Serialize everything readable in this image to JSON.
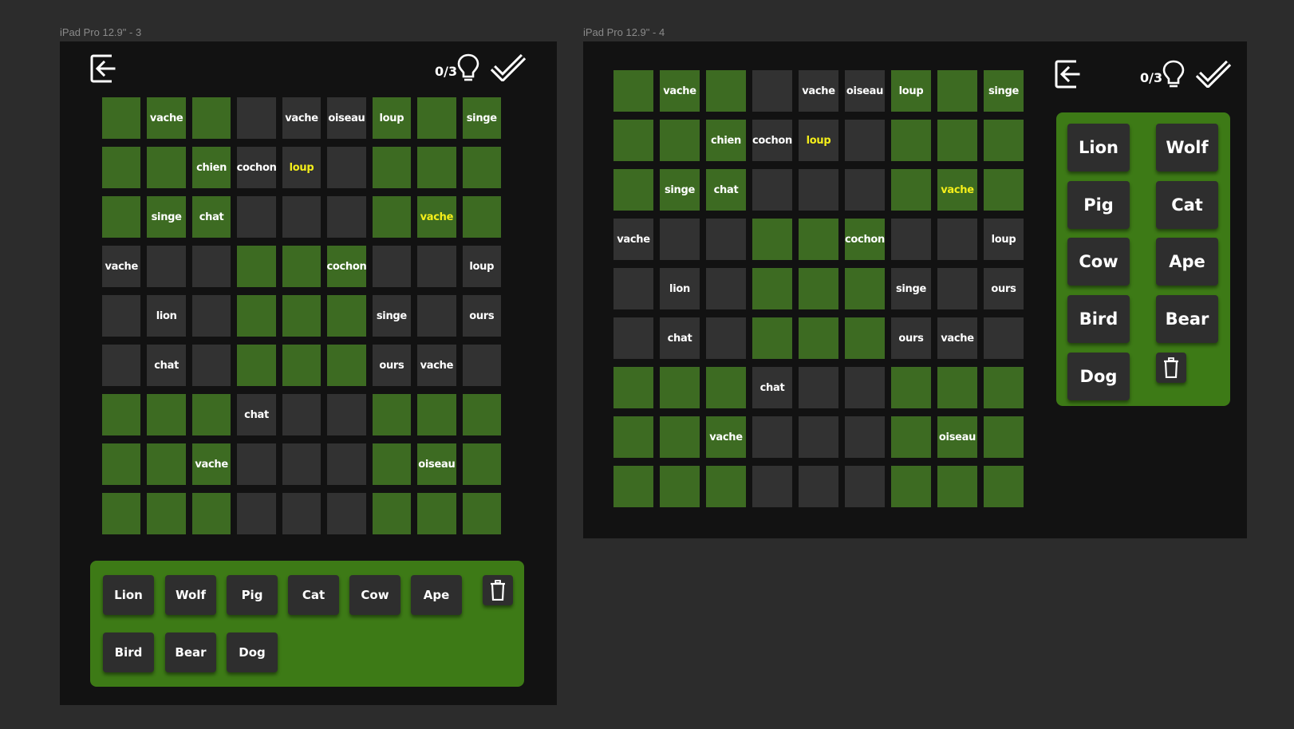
{
  "frames": [
    {
      "label": "iPad Pro 12.9\" - 3",
      "score": "0/3",
      "words": [
        "Lion",
        "Wolf",
        "Pig",
        "Cat",
        "Cow",
        "Ape",
        "Bird",
        "Bear",
        "Dog"
      ],
      "grid": [
        [
          [
            "g",
            ""
          ],
          [
            "g",
            "vache"
          ],
          [
            "g",
            ""
          ],
          [
            "d",
            ""
          ],
          [
            "d",
            "vache"
          ],
          [
            "d",
            "oiseau"
          ],
          [
            "g",
            "loup"
          ],
          [
            "g",
            ""
          ],
          [
            "g",
            "singe"
          ]
        ],
        [
          [
            "g",
            ""
          ],
          [
            "g",
            ""
          ],
          [
            "g",
            "chien"
          ],
          [
            "d",
            "cochon"
          ],
          [
            "dy",
            "loup"
          ],
          [
            "d",
            ""
          ],
          [
            "g",
            ""
          ],
          [
            "g",
            ""
          ],
          [
            "g",
            ""
          ]
        ],
        [
          [
            "g",
            ""
          ],
          [
            "g",
            "singe"
          ],
          [
            "g",
            "chat"
          ],
          [
            "d",
            ""
          ],
          [
            "d",
            ""
          ],
          [
            "d",
            ""
          ],
          [
            "g",
            ""
          ],
          [
            "gy",
            "vache"
          ],
          [
            "g",
            ""
          ]
        ],
        [
          [
            "d",
            "vache"
          ],
          [
            "d",
            ""
          ],
          [
            "d",
            ""
          ],
          [
            "g",
            ""
          ],
          [
            "g",
            ""
          ],
          [
            "g",
            "cochon"
          ],
          [
            "d",
            ""
          ],
          [
            "d",
            ""
          ],
          [
            "d",
            "loup"
          ]
        ],
        [
          [
            "d",
            ""
          ],
          [
            "d",
            "lion"
          ],
          [
            "d",
            ""
          ],
          [
            "g",
            ""
          ],
          [
            "g",
            ""
          ],
          [
            "g",
            ""
          ],
          [
            "d",
            "singe"
          ],
          [
            "d",
            ""
          ],
          [
            "d",
            "ours"
          ]
        ],
        [
          [
            "d",
            ""
          ],
          [
            "d",
            "chat"
          ],
          [
            "d",
            ""
          ],
          [
            "g",
            ""
          ],
          [
            "g",
            ""
          ],
          [
            "g",
            ""
          ],
          [
            "d",
            "ours"
          ],
          [
            "d",
            "vache"
          ],
          [
            "d",
            ""
          ]
        ],
        [
          [
            "g",
            ""
          ],
          [
            "g",
            ""
          ],
          [
            "g",
            ""
          ],
          [
            "d",
            "chat"
          ],
          [
            "d",
            ""
          ],
          [
            "d",
            ""
          ],
          [
            "g",
            ""
          ],
          [
            "g",
            ""
          ],
          [
            "g",
            ""
          ]
        ],
        [
          [
            "g",
            ""
          ],
          [
            "g",
            ""
          ],
          [
            "g",
            "vache"
          ],
          [
            "d",
            ""
          ],
          [
            "d",
            ""
          ],
          [
            "d",
            ""
          ],
          [
            "g",
            ""
          ],
          [
            "g",
            "oiseau"
          ],
          [
            "g",
            ""
          ]
        ],
        [
          [
            "g",
            ""
          ],
          [
            "g",
            ""
          ],
          [
            "g",
            ""
          ],
          [
            "d",
            ""
          ],
          [
            "d",
            ""
          ],
          [
            "d",
            ""
          ],
          [
            "g",
            ""
          ],
          [
            "g",
            ""
          ],
          [
            "g",
            ""
          ]
        ]
      ]
    },
    {
      "label": "iPad Pro 12.9\" - 4",
      "score": "0/3",
      "words": [
        "Lion",
        "Wolf",
        "Pig",
        "Cat",
        "Cow",
        "Ape",
        "Bird",
        "Bear",
        "Dog"
      ],
      "grid": [
        [
          [
            "g",
            ""
          ],
          [
            "g",
            "vache"
          ],
          [
            "g",
            ""
          ],
          [
            "d",
            ""
          ],
          [
            "d",
            "vache"
          ],
          [
            "d",
            "oiseau"
          ],
          [
            "g",
            "loup"
          ],
          [
            "g",
            ""
          ],
          [
            "g",
            "singe"
          ]
        ],
        [
          [
            "g",
            ""
          ],
          [
            "g",
            ""
          ],
          [
            "g",
            "chien"
          ],
          [
            "d",
            "cochon"
          ],
          [
            "dy",
            "loup"
          ],
          [
            "d",
            ""
          ],
          [
            "g",
            ""
          ],
          [
            "g",
            ""
          ],
          [
            "g",
            ""
          ]
        ],
        [
          [
            "g",
            ""
          ],
          [
            "g",
            "singe"
          ],
          [
            "g",
            "chat"
          ],
          [
            "d",
            ""
          ],
          [
            "d",
            ""
          ],
          [
            "d",
            ""
          ],
          [
            "g",
            ""
          ],
          [
            "gy",
            "vache"
          ],
          [
            "g",
            ""
          ]
        ],
        [
          [
            "d",
            "vache"
          ],
          [
            "d",
            ""
          ],
          [
            "d",
            ""
          ],
          [
            "g",
            ""
          ],
          [
            "g",
            ""
          ],
          [
            "g",
            "cochon"
          ],
          [
            "d",
            ""
          ],
          [
            "d",
            ""
          ],
          [
            "d",
            "loup"
          ]
        ],
        [
          [
            "d",
            ""
          ],
          [
            "d",
            "lion"
          ],
          [
            "d",
            ""
          ],
          [
            "g",
            ""
          ],
          [
            "g",
            ""
          ],
          [
            "g",
            ""
          ],
          [
            "d",
            "singe"
          ],
          [
            "d",
            ""
          ],
          [
            "d",
            "ours"
          ]
        ],
        [
          [
            "d",
            ""
          ],
          [
            "d",
            "chat"
          ],
          [
            "d",
            ""
          ],
          [
            "g",
            ""
          ],
          [
            "g",
            ""
          ],
          [
            "g",
            ""
          ],
          [
            "d",
            "ours"
          ],
          [
            "d",
            "vache"
          ],
          [
            "d",
            ""
          ]
        ],
        [
          [
            "g",
            ""
          ],
          [
            "g",
            ""
          ],
          [
            "g",
            ""
          ],
          [
            "d",
            "chat"
          ],
          [
            "d",
            ""
          ],
          [
            "d",
            ""
          ],
          [
            "g",
            ""
          ],
          [
            "g",
            ""
          ],
          [
            "g",
            ""
          ]
        ],
        [
          [
            "g",
            ""
          ],
          [
            "g",
            ""
          ],
          [
            "g",
            "vache"
          ],
          [
            "d",
            ""
          ],
          [
            "d",
            ""
          ],
          [
            "d",
            ""
          ],
          [
            "g",
            ""
          ],
          [
            "g",
            "oiseau"
          ],
          [
            "g",
            ""
          ]
        ],
        [
          [
            "g",
            ""
          ],
          [
            "g",
            ""
          ],
          [
            "g",
            ""
          ],
          [
            "d",
            ""
          ],
          [
            "d",
            ""
          ],
          [
            "d",
            ""
          ],
          [
            "g",
            ""
          ],
          [
            "g",
            ""
          ],
          [
            "g",
            ""
          ]
        ]
      ]
    }
  ],
  "colors": {
    "canvas": "#2c2c2c",
    "frame": "#121212",
    "cell_green": "#3d6b22",
    "cell_dark": "#323232",
    "panel_green": "#3d7a16",
    "highlight_text": "#f4ee1a"
  },
  "icons": [
    "exit-icon",
    "lightbulb-icon",
    "checkmark-icon",
    "trash-icon"
  ]
}
